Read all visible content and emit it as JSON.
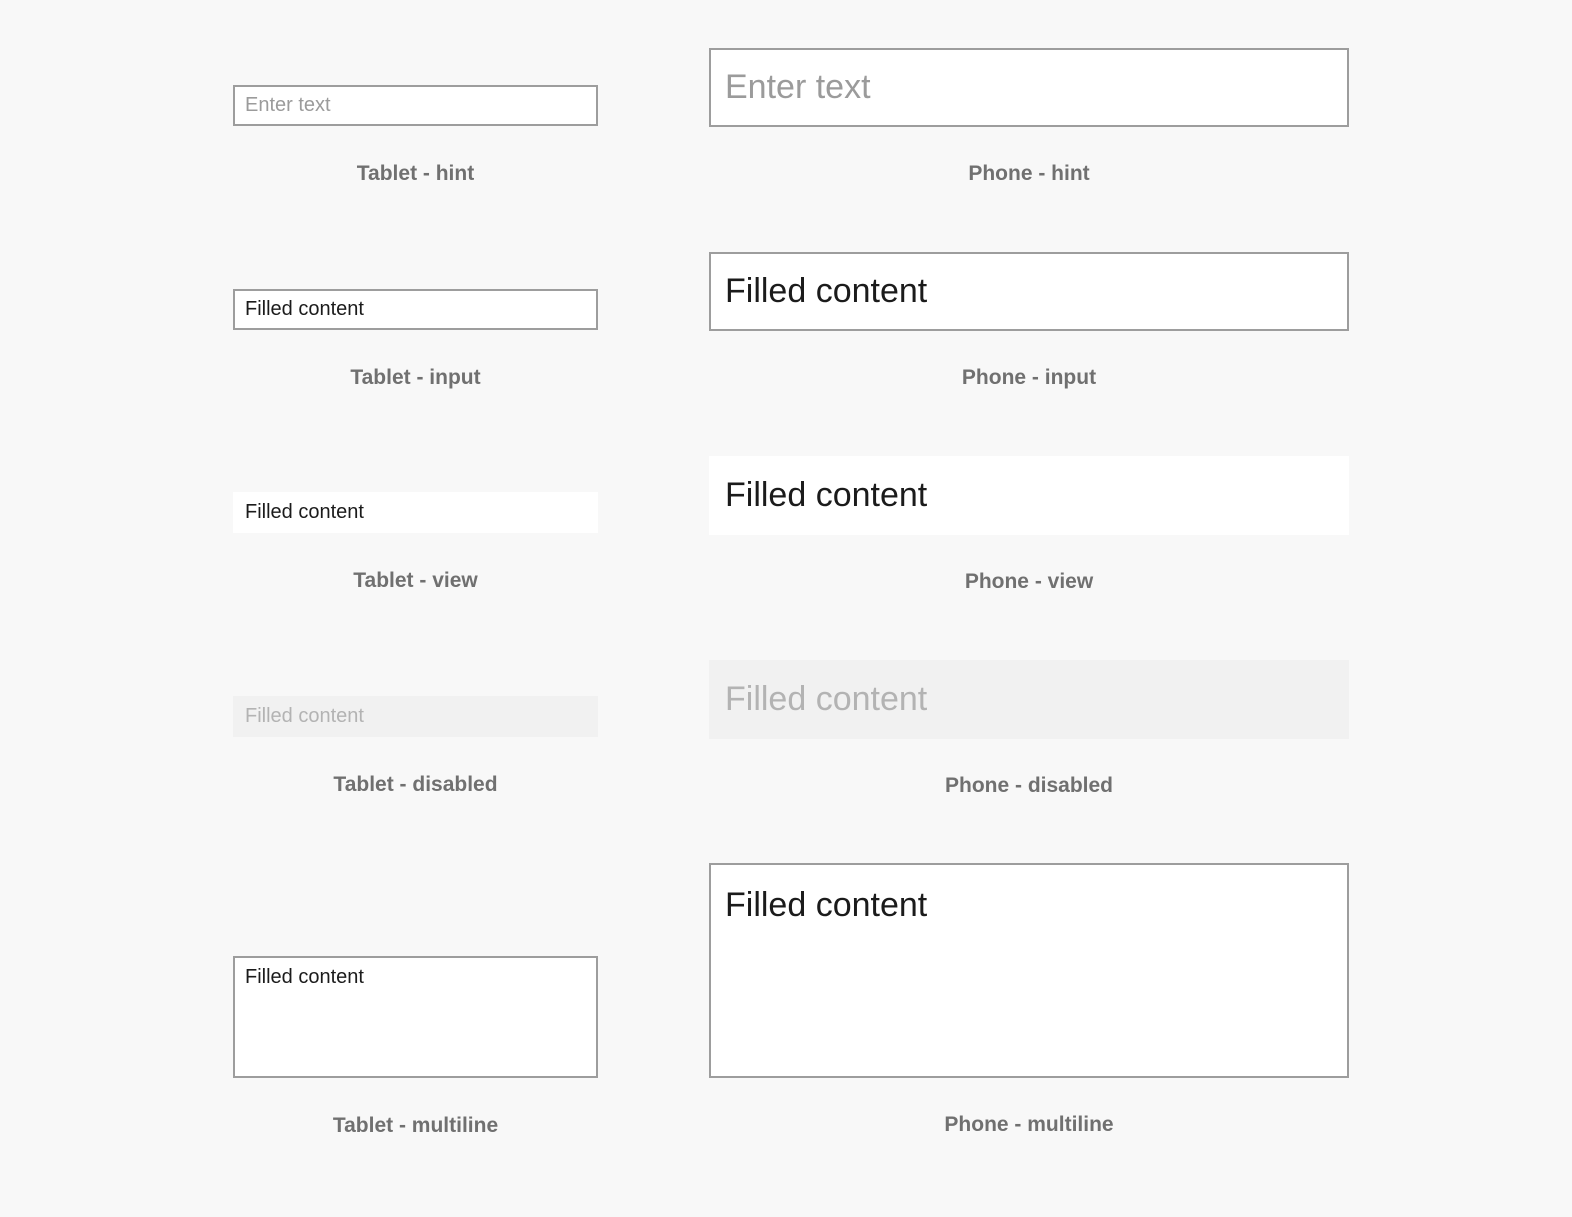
{
  "page": {
    "background_color": "#f8f8f8",
    "control_border_color": "#9d9d9d",
    "control_fill_color": "#ffffff",
    "disabled_fill_color": "#f1f1f1",
    "value_text_color": "#1b1b1b",
    "hint_text_color": "#9b9b9b",
    "disabled_text_color": "#b3b3b3",
    "caption_text_color": "#707070"
  },
  "columns": [
    {
      "form_factor": "Tablet",
      "rows": [
        {
          "state": "hint",
          "caption": "Tablet - hint",
          "value": "",
          "placeholder": "Enter text",
          "display_text": "Enter text",
          "text_style": "hint",
          "bordered": true,
          "multiline": false
        },
        {
          "state": "input",
          "caption": "Tablet - input",
          "value": "Filled content",
          "placeholder": "Enter text",
          "display_text": "Filled content",
          "text_style": "value",
          "bordered": true,
          "multiline": false
        },
        {
          "state": "view",
          "caption": "Tablet - view",
          "value": "Filled content",
          "placeholder": "Enter text",
          "display_text": "Filled content",
          "text_style": "value",
          "bordered": false,
          "multiline": false
        },
        {
          "state": "disabled",
          "caption": "Tablet - disabled",
          "value": "Filled content",
          "placeholder": "Enter text",
          "display_text": "Filled content",
          "text_style": "disabled",
          "bordered": false,
          "multiline": false
        },
        {
          "state": "multiline",
          "caption": "Tablet - multiline",
          "value": "Filled content",
          "placeholder": "Enter text",
          "display_text": "Filled content",
          "text_style": "value",
          "bordered": true,
          "multiline": true
        }
      ]
    },
    {
      "form_factor": "Phone",
      "rows": [
        {
          "state": "hint",
          "caption": "Phone - hint",
          "value": "",
          "placeholder": "Enter text",
          "display_text": "Enter text",
          "text_style": "hint",
          "bordered": true,
          "multiline": false
        },
        {
          "state": "input",
          "caption": "Phone - input",
          "value": "Filled content",
          "placeholder": "Enter text",
          "display_text": "Filled content",
          "text_style": "value",
          "bordered": true,
          "multiline": false
        },
        {
          "state": "view",
          "caption": "Phone - view",
          "value": "Filled content",
          "placeholder": "Enter text",
          "display_text": "Filled content",
          "text_style": "value",
          "bordered": false,
          "multiline": false
        },
        {
          "state": "disabled",
          "caption": "Phone - disabled",
          "value": "Filled content",
          "placeholder": "Enter text",
          "display_text": "Filled content",
          "text_style": "disabled",
          "bordered": false,
          "multiline": false
        },
        {
          "state": "multiline",
          "caption": "Phone - multiline",
          "value": "Filled content",
          "placeholder": "Enter text",
          "display_text": "Filled content",
          "text_style": "value",
          "bordered": true,
          "multiline": true
        }
      ]
    }
  ]
}
